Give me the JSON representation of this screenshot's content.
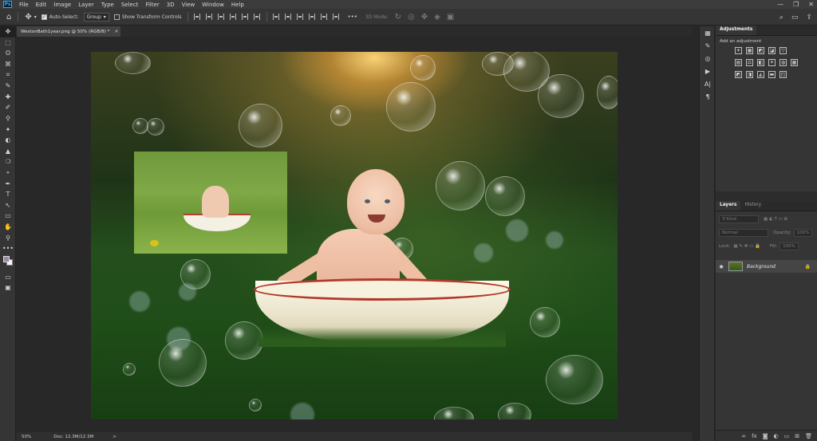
{
  "app": {
    "logo": "Ps"
  },
  "menu": [
    "File",
    "Edit",
    "Image",
    "Layer",
    "Type",
    "Select",
    "Filter",
    "3D",
    "View",
    "Window",
    "Help"
  ],
  "window_controls": {
    "minimize": "—",
    "restore": "❐",
    "close": "✕"
  },
  "options_bar": {
    "home_icon": "⌂",
    "move_icon": "✥",
    "auto_select_label": "Auto-Select:",
    "auto_select_checked": true,
    "auto_select_value": "Group",
    "show_transform_label": "Show Transform Controls",
    "show_transform_checked": false,
    "more_icon": "•••",
    "mode_3d_label": "3D Mode:",
    "search_icon": "⌕",
    "workspace_icon": "▭",
    "share_icon": "⇪"
  },
  "document_tab": {
    "title": "WestonBath1year.png @ 50% (RGB/8) *",
    "close": "×"
  },
  "tools": [
    "✥",
    "⬚",
    "ʘ",
    "⌘",
    "⌗",
    "✎",
    "✚",
    "✐",
    "⚲",
    "✦",
    "◐",
    "▲",
    "❍",
    "⚬",
    "✒",
    "T",
    "↖",
    "▭",
    "✋",
    "⚲",
    "•••"
  ],
  "colors": {
    "foreground": "#9a8aa6",
    "background": "#f5f5f5",
    "accent": "#31a8ff"
  },
  "panel_strip": [
    "▦",
    "✎",
    "◎",
    "▶",
    "A|",
    "¶"
  ],
  "adjustments": {
    "tab_label": "Adjustments",
    "hint": "Add an adjustment",
    "row1": [
      "☀",
      "▦",
      "◩",
      "◪",
      "▽"
    ],
    "row2": [
      "▤",
      "⚖",
      "◧",
      "⚘",
      "◍",
      "▦"
    ],
    "row3": [
      "◩",
      "◨",
      "◭",
      "▬",
      "◰"
    ]
  },
  "layers": {
    "tabs": [
      "Layers",
      "History"
    ],
    "kind_placeholder": "Kind",
    "blend_mode": "Normal",
    "opacity_label": "Opacity:",
    "opacity_value": "100%",
    "lock_label": "Lock:",
    "fill_label": "Fill:",
    "fill_value": "100%",
    "layer_name": "Background",
    "layer_eye": "◉",
    "layer_lock": "🔒",
    "footer_icons": [
      "∞",
      "fx",
      "◙",
      "◐",
      "▭",
      "⊞",
      "🗑"
    ]
  },
  "status": {
    "zoom": "50%",
    "doc_info": "Doc: 12.3M/12.3M",
    "arrow": ">"
  }
}
